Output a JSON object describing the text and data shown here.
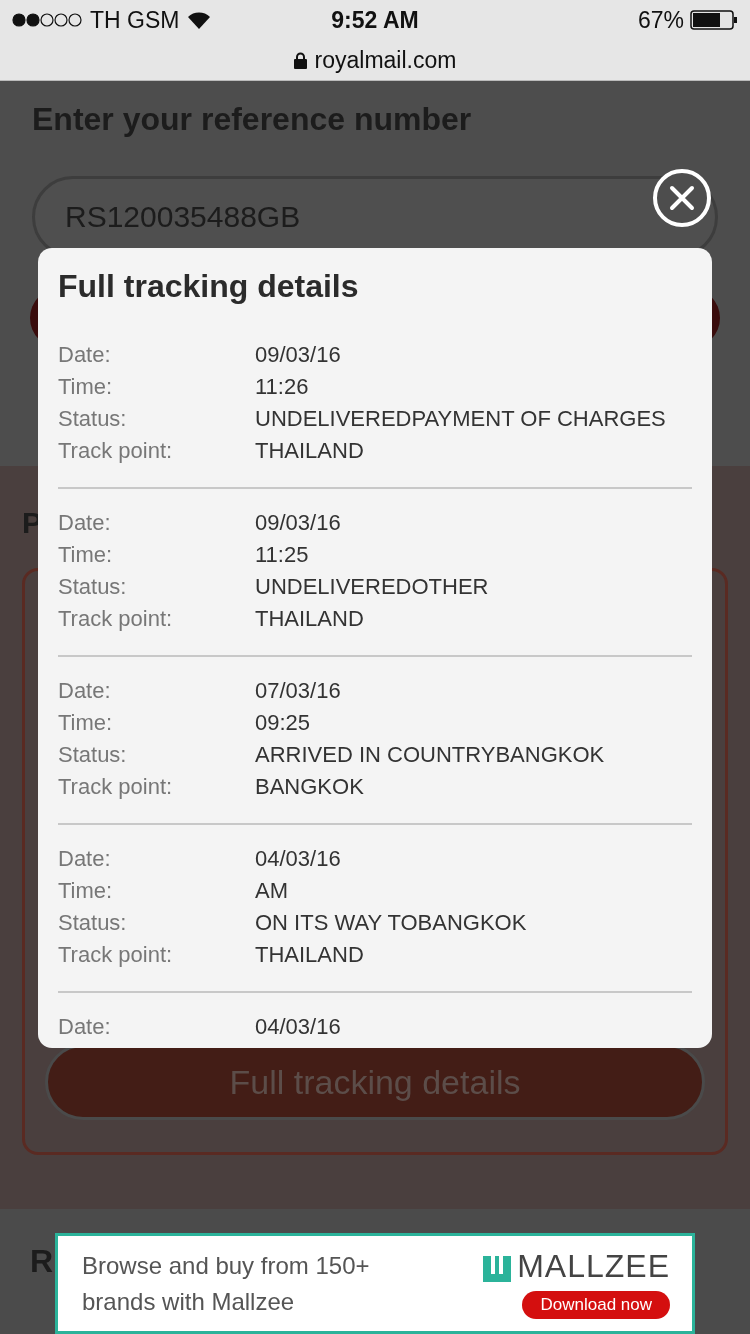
{
  "status_bar": {
    "carrier": "TH GSM",
    "time": "9:52 AM",
    "battery": "67%"
  },
  "address_bar": {
    "url": "royalmail.com"
  },
  "page": {
    "heading": "Enter your reference number",
    "reference_field": {
      "value": "RS120035488GB"
    },
    "section_heading_fragment": "P",
    "details_button": "Full tracking details",
    "footer_heading_fragment": "R"
  },
  "modal": {
    "title": "Full tracking details",
    "entries": [
      {
        "fields": [
          {
            "label": "Date:",
            "value": "09/03/16"
          },
          {
            "label": "Time:",
            "value": "11:26"
          },
          {
            "label": "Status:",
            "value": "UNDELIVEREDPAYMENT OF CHARGES"
          },
          {
            "label": "Track point:",
            "value": "THAILAND"
          }
        ]
      },
      {
        "fields": [
          {
            "label": "Date:",
            "value": "09/03/16"
          },
          {
            "label": "Time:",
            "value": "11:25"
          },
          {
            "label": "Status:",
            "value": "UNDELIVEREDOTHER"
          },
          {
            "label": "Track point:",
            "value": "THAILAND"
          }
        ]
      },
      {
        "fields": [
          {
            "label": "Date:",
            "value": "07/03/16"
          },
          {
            "label": "Time:",
            "value": "09:25"
          },
          {
            "label": "Status:",
            "value": "ARRIVED IN COUNTRYBANGKOK"
          },
          {
            "label": "Track point:",
            "value": "BANGKOK"
          }
        ]
      },
      {
        "fields": [
          {
            "label": "Date:",
            "value": "04/03/16"
          },
          {
            "label": "Time:",
            "value": "AM"
          },
          {
            "label": "Status:",
            "value": "ON ITS WAY TOBANGKOK"
          },
          {
            "label": "Track point:",
            "value": "THAILAND"
          }
        ]
      },
      {
        "fields": [
          {
            "label": "Date:",
            "value": "04/03/16"
          }
        ]
      }
    ]
  },
  "ad": {
    "text": "Browse and buy from 150+ brands with Mallzee",
    "brand": "MALLZEE",
    "cta": "Download now"
  }
}
